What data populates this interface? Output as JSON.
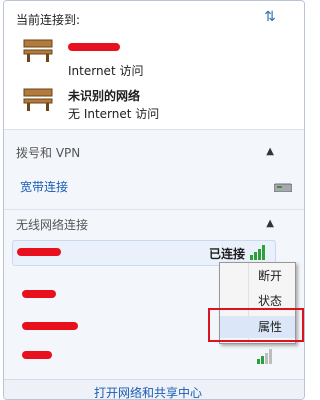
{
  "header": {
    "title": "当前连接到:",
    "refresh_icon": "refresh-icon"
  },
  "networks": [
    {
      "name_line1": "",
      "name_line2": "Internet 访问"
    },
    {
      "name_line1": "未识别的网络",
      "name_line2": "无 Internet 访问"
    }
  ],
  "dialup": {
    "title": "拨号和 VPN",
    "items": [
      {
        "label": "宽带连接"
      }
    ]
  },
  "wireless": {
    "title": "无线网络连接",
    "connected": {
      "status": "已连接"
    }
  },
  "context_menu": {
    "items": [
      "断开",
      "状态",
      "属性"
    ]
  },
  "footer": {
    "link": "打开网络和共享中心"
  },
  "colors": {
    "accent": "#1a5cb5",
    "highlight": "#d9141e",
    "redact": "#e8101c"
  }
}
